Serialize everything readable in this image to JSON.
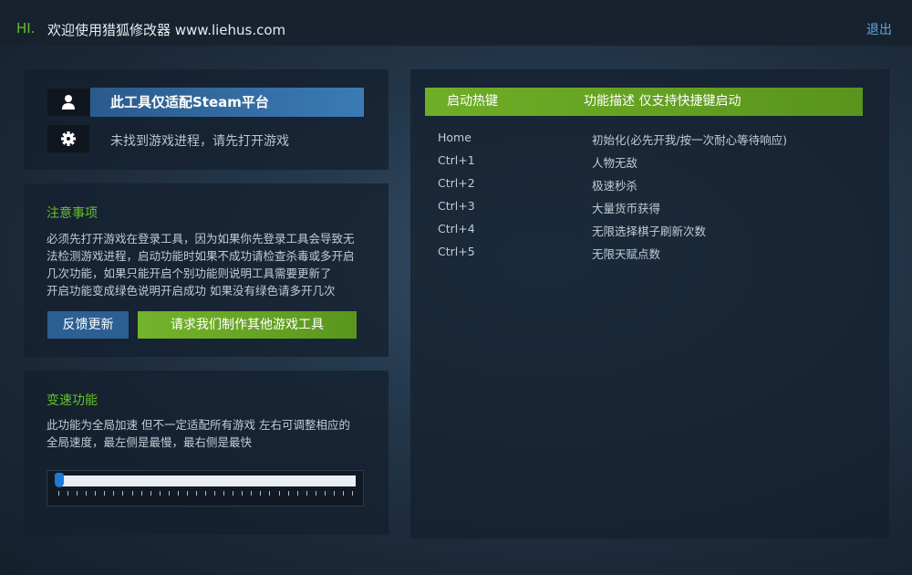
{
  "header": {
    "greeting": "HI.",
    "title": "欢迎使用猎狐修改器 www.liehus.com",
    "logout_label": "退出"
  },
  "status_panel": {
    "platform_text": "此工具仅适配Steam平台",
    "status_text": "未找到游戏进程，请先打开游戏",
    "icons": [
      "user-icon",
      "gear-icon"
    ]
  },
  "notes_panel": {
    "title": "注意事项",
    "lines": [
      "必须先打开游戏在登录工具，因为如果你先登录工具会导致无",
      "法检测游戏进程，启动功能时如果不成功请检查杀毒或多开启",
      "几次功能，如果只能开启个别功能则说明工具需要更新了",
      "开启功能变成绿色说明开启成功 如果没有绿色请多开几次"
    ],
    "feedback_button": "反馈更新",
    "request_button": "请求我们制作其他游戏工具"
  },
  "speed_panel": {
    "title": "变速功能",
    "lines": [
      "此功能为全局加速 但不一定适配所有游戏 左右可调整相应的",
      "全局速度，最左侧是最慢，最右侧是最快"
    ],
    "slider_value": 0
  },
  "hotkeys_panel": {
    "col_key": "启动热键",
    "col_desc": "功能描述 仅支持快捷键启动",
    "rows": [
      {
        "key": "Home",
        "desc": "初始化(必先开我/按一次耐心等待响应)"
      },
      {
        "key": "Ctrl+1",
        "desc": "人物无敌"
      },
      {
        "key": "Ctrl+2",
        "desc": "极速秒杀"
      },
      {
        "key": "Ctrl+3",
        "desc": "大量货币获得"
      },
      {
        "key": "Ctrl+4",
        "desc": "无限选择棋子刷新次数"
      },
      {
        "key": "Ctrl+5",
        "desc": "无限天赋点数"
      }
    ]
  },
  "colors": {
    "accent_green": "#62c12a",
    "accent_blue": "#2c5f92",
    "link_blue": "#5aa7e4",
    "background": "#1b2838"
  }
}
